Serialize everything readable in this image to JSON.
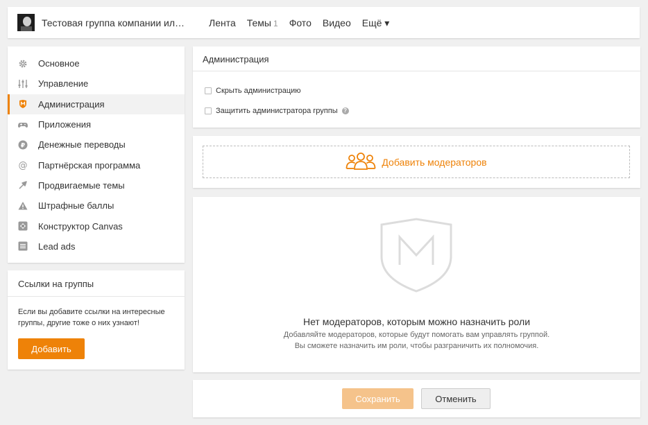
{
  "header": {
    "group_title": "Тестовая группа компании ил…",
    "nav": [
      {
        "label": "Лента"
      },
      {
        "label": "Темы",
        "count": "1"
      },
      {
        "label": "Фото"
      },
      {
        "label": "Видео"
      },
      {
        "label": "Ещё ▾"
      }
    ]
  },
  "sidebar": {
    "items": [
      {
        "label": "Основное",
        "icon": "gear-icon"
      },
      {
        "label": "Управление",
        "icon": "sliders-icon"
      },
      {
        "label": "Администрация",
        "icon": "moderator-shield-icon",
        "active": true
      },
      {
        "label": "Приложения",
        "icon": "gamepad-icon"
      },
      {
        "label": "Денежные переводы",
        "icon": "money-transfer-icon"
      },
      {
        "label": "Партнёрская программа",
        "icon": "at-icon"
      },
      {
        "label": "Продвигаемые темы",
        "icon": "promote-arrow-icon"
      },
      {
        "label": "Штрафные баллы",
        "icon": "warning-icon"
      },
      {
        "label": "Конструктор Canvas",
        "icon": "canvas-icon"
      },
      {
        "label": "Lead ads",
        "icon": "list-icon"
      }
    ]
  },
  "links": {
    "title": "Ссылки на группы",
    "text": "Если вы добавите ссылки на интересные группы, другие тоже о них узнают!",
    "button": "Добавить"
  },
  "admin": {
    "title": "Администрация",
    "hide_admin": "Скрыть администрацию",
    "protect_admin": "Защитить администратора группы",
    "help": "?"
  },
  "add_moderators": {
    "label": "Добавить модераторов"
  },
  "empty": {
    "title": "Нет модераторов, которым можно назначить роли",
    "line1": "Добавляйте модераторов, которые будут помогать вам управлять группой.",
    "line2": "Вы сможете назначить им роли, чтобы разграничить их полномочия."
  },
  "footer": {
    "save": "Сохранить",
    "cancel": "Отменить"
  },
  "colors": {
    "accent": "#ee8208",
    "accent_disabled": "#f5c38b"
  }
}
